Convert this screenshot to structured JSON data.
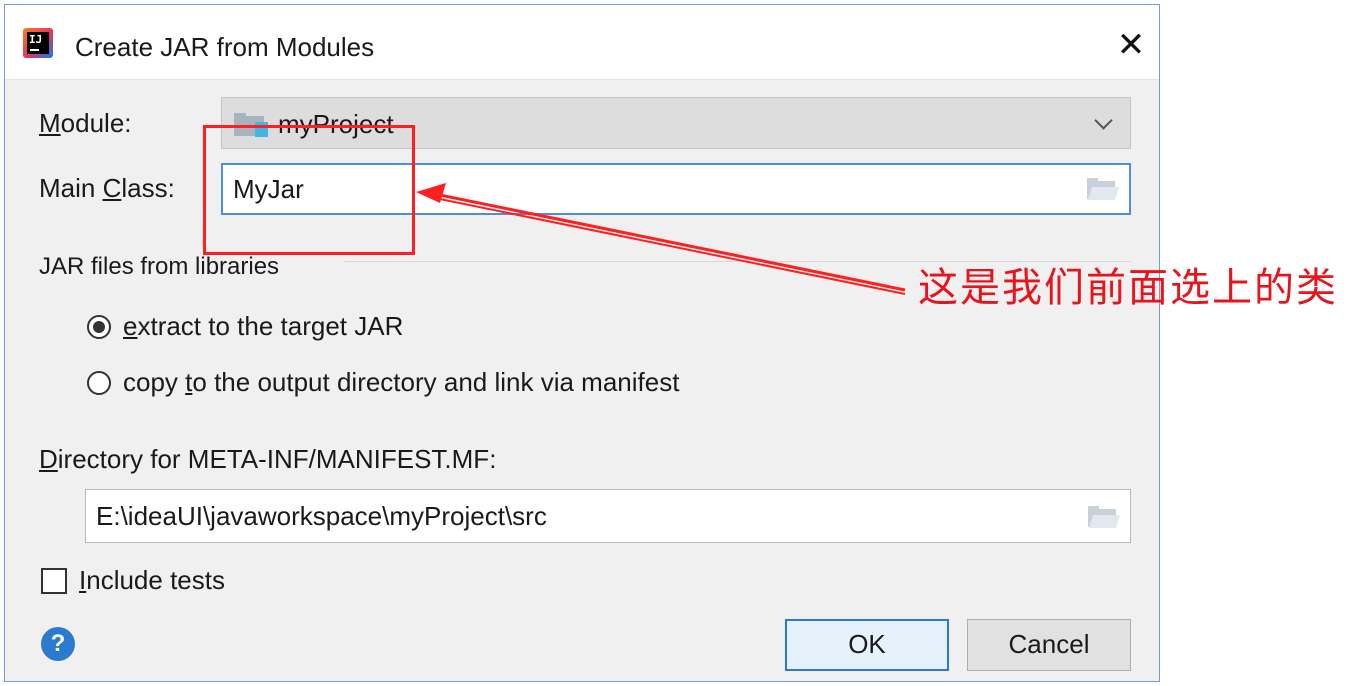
{
  "window": {
    "title": "Create JAR from Modules",
    "close_glyph": "✕",
    "app_icon": "intellij-idea-icon"
  },
  "module": {
    "label_prefix": "",
    "label_underlined": "M",
    "label_rest": "odule:",
    "value": "myProject",
    "folder_icon": "module-folder-icon"
  },
  "main_class": {
    "label_prefix": "Main ",
    "label_underlined": "C",
    "label_rest": "lass:",
    "value": "MyJar"
  },
  "jar_section": {
    "title": "JAR files from libraries"
  },
  "options": [
    {
      "prefix": "",
      "underlined": "e",
      "rest": "xtract to the target JAR",
      "selected": true
    },
    {
      "prefix": "copy ",
      "underlined": "t",
      "rest": "o the output directory and link via manifest",
      "selected": false
    }
  ],
  "manifest": {
    "label_underlined": "D",
    "label_rest": "irectory for META-INF/MANIFEST.MF:",
    "value": "E:\\ideaUI\\javaworkspace\\myProject\\src"
  },
  "include_tests": {
    "label_underlined": "I",
    "label_rest": "nclude tests",
    "checked": false
  },
  "help": {
    "glyph": "?"
  },
  "buttons": {
    "ok": "OK",
    "cancel": "Cancel"
  },
  "annotation": {
    "text": "这是我们前面选上的类",
    "color": "#e8141c"
  },
  "colors": {
    "accent": "#2b79d6",
    "dialog_bg": "#f0f0f0",
    "annotation": "#ff1f1f"
  }
}
